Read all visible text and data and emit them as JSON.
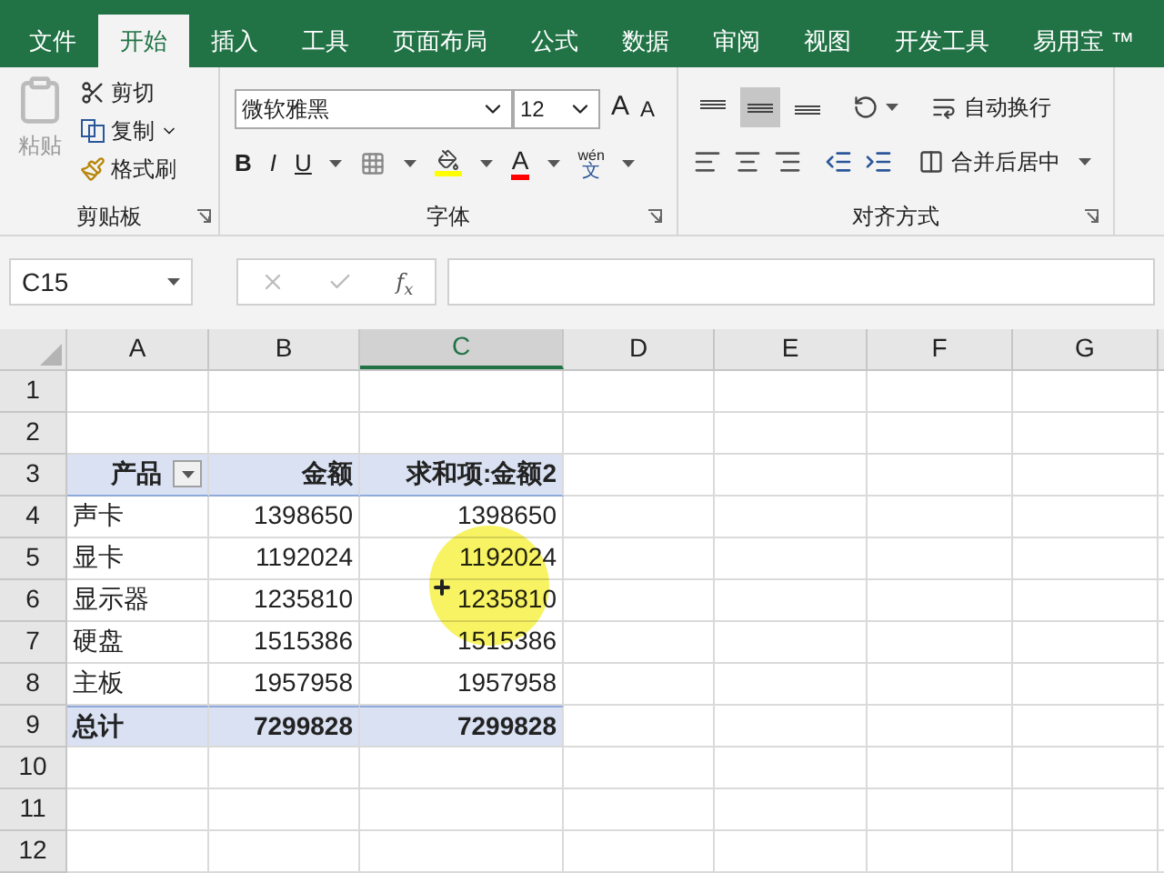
{
  "ribbon_tabs": [
    {
      "label": "文件",
      "selected": false
    },
    {
      "label": "开始",
      "selected": true
    },
    {
      "label": "插入",
      "selected": false
    },
    {
      "label": "工具",
      "selected": false
    },
    {
      "label": "页面布局",
      "selected": false
    },
    {
      "label": "公式",
      "selected": false
    },
    {
      "label": "数据",
      "selected": false
    },
    {
      "label": "审阅",
      "selected": false
    },
    {
      "label": "视图",
      "selected": false
    },
    {
      "label": "开发工具",
      "selected": false
    },
    {
      "label": "易用宝 ™",
      "selected": false
    }
  ],
  "clipboard": {
    "paste": "粘贴",
    "cut": "剪切",
    "copy": "复制",
    "format_painter": "格式刷",
    "title": "剪贴板"
  },
  "font": {
    "name": "微软雅黑",
    "size": "12",
    "grow": "A",
    "shrink": "A",
    "bold": "B",
    "italic": "I",
    "underline": "U",
    "font_color": "A",
    "phonetic_top": "wén",
    "phonetic_bottom": "文",
    "title": "字体"
  },
  "alignment": {
    "vertical": [
      {
        "selected": false
      },
      {
        "selected": true
      },
      {
        "selected": false
      }
    ],
    "wrap": "自动换行",
    "merge": "合并后居中",
    "title": "对齐方式"
  },
  "formula_bar": {
    "name_box": "C15",
    "function_button": "f$_{x}$"
  },
  "sheet": {
    "columns": [
      {
        "label": "A",
        "selected": false
      },
      {
        "label": "B",
        "selected": false
      },
      {
        "label": "C",
        "selected": true
      },
      {
        "label": "D",
        "selected": false
      },
      {
        "label": "E",
        "selected": false
      },
      {
        "label": "F",
        "selected": false
      },
      {
        "label": "G",
        "selected": false
      }
    ],
    "rows": [
      {
        "label": "1",
        "kind": "empty"
      },
      {
        "label": "2",
        "kind": "empty"
      },
      {
        "label": "3",
        "kind": "header",
        "cells": [
          "产品",
          "金额",
          "求和项:金额2"
        ]
      },
      {
        "label": "4",
        "kind": "item",
        "cells": [
          "声卡",
          "1398650",
          "1398650"
        ]
      },
      {
        "label": "5",
        "kind": "item",
        "cells": [
          "显卡",
          "1192024",
          "1192024"
        ]
      },
      {
        "label": "6",
        "kind": "item",
        "cells": [
          "显示器",
          "1235810",
          "1235810"
        ]
      },
      {
        "label": "7",
        "kind": "item",
        "cells": [
          "硬盘",
          "1515386",
          "1515386"
        ]
      },
      {
        "label": "8",
        "kind": "item",
        "cells": [
          "主板",
          "1957958",
          "1957958"
        ]
      },
      {
        "label": "9",
        "kind": "total",
        "cells": [
          "总计",
          "7299828",
          "7299828"
        ]
      },
      {
        "label": "10",
        "kind": "empty"
      },
      {
        "label": "11",
        "kind": "empty"
      },
      {
        "label": "12",
        "kind": "empty"
      }
    ]
  }
}
